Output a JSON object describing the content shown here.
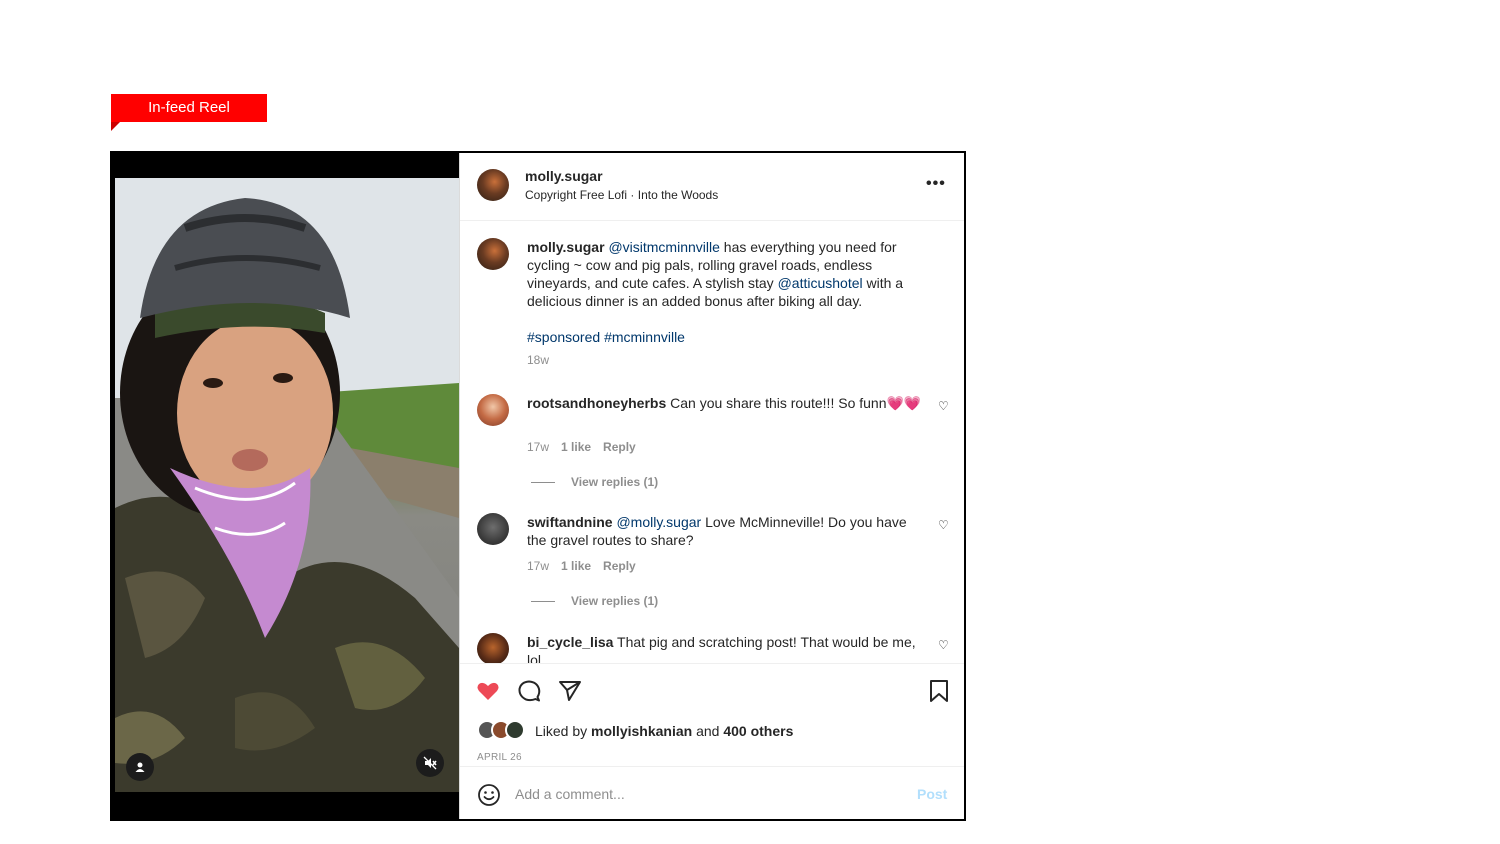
{
  "tag": {
    "label": "In-feed Reel",
    "color": "#ff0000"
  },
  "post": {
    "username": "molly.sugar",
    "audio": "Copyright Free Lofi",
    "audio_separator": "·",
    "audio_track": "Into the Woods",
    "more_icon": "more-horizontal-icon",
    "caption": {
      "username": "molly.sugar",
      "mention1": "@visitmcminnville",
      "text1": " has everything you need for cycling ~ cow and pig pals, rolling gravel roads, endless vineyards, and cute cafes. A stylish stay ",
      "mention2": "@atticushotel",
      "text2": " with a delicious dinner is an added bonus after biking all day.",
      "hashtag1": "#sponsored",
      "hashtag2": "#mcminnville",
      "time": "18w"
    },
    "comments": [
      {
        "username": "rootsandhoneyherbs",
        "text": " Can you share this route!!! So funn💗💗",
        "time": "17w",
        "likes": "1 like",
        "reply": "Reply",
        "view_replies": "View replies (1)"
      },
      {
        "username": "swiftandnine",
        "mention": "@molly.sugar",
        "text": " Love McMinneville! Do you have the gravel routes to share?",
        "time": "17w",
        "likes": "1 like",
        "reply": "Reply",
        "view_replies": "View replies (1)"
      },
      {
        "username": "bi_cycle_lisa",
        "text": " That pig and scratching post! That would be me, lol"
      }
    ],
    "liked_by_prefix": "Liked by ",
    "liked_by_user": "mollyishkanian",
    "liked_by_and": " and ",
    "liked_by_others": "400 others",
    "date": "APRIL 26",
    "comment_placeholder": "Add a comment...",
    "post_label": "Post",
    "liked": true
  },
  "colors": {
    "like_red": "#ed4956",
    "link_blue": "#00376b",
    "post_disabled": "#b2dffc"
  }
}
